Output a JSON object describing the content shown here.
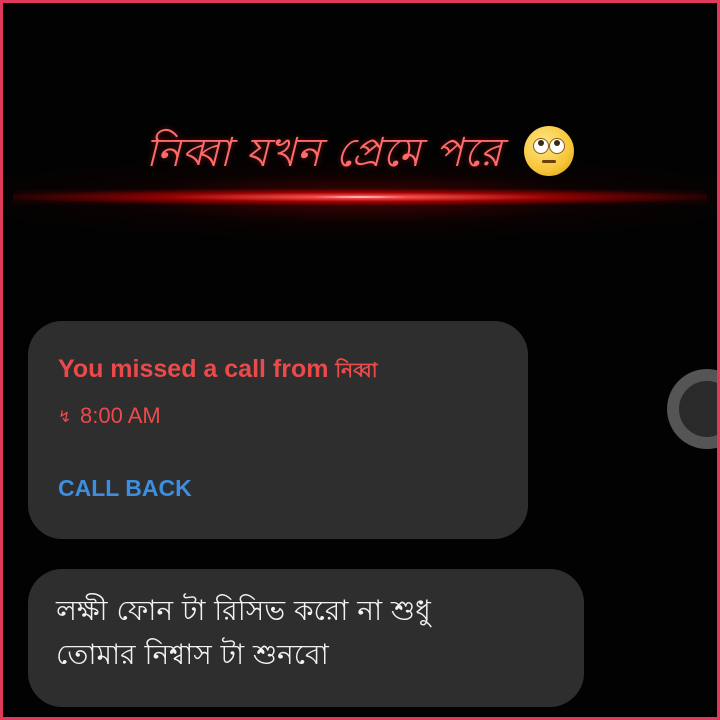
{
  "header": {
    "title": "নিব্বা যখন প্রেমে পরে",
    "emoji": "eye-roll-emoji"
  },
  "missed_call": {
    "prefix": "You missed a call from",
    "caller": "নিব্বা",
    "time": "8:00 AM",
    "icon": "missed-call-icon",
    "action_label": "CALL BACK"
  },
  "message": {
    "line1": "লক্ষী ফোন টা রিসিভ করো না শুধু",
    "line2": "তোমার নিশ্বাস টা শুনবো"
  },
  "colors": {
    "background": "#000000",
    "border": "#e03a5a",
    "title": "#ff6a6a",
    "bubble": "#2e2e2e",
    "missed_red": "#ec4a4a",
    "call_back_blue": "#3b8ee0",
    "message_text": "#f2f2f2"
  }
}
